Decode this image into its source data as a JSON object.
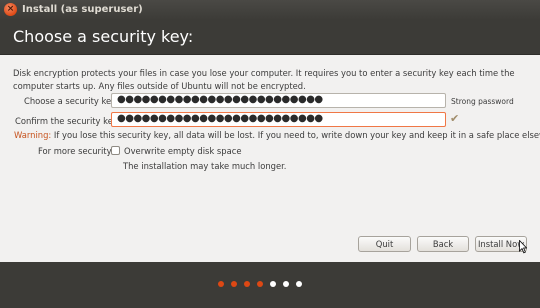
{
  "window": {
    "title": "Install (as superuser)",
    "close_glyph": "×"
  },
  "header": {
    "title": "Choose a security key:"
  },
  "main": {
    "description": "Disk encryption protects your files in case you lose your computer. It requires you to enter a security key each time the computer starts up. Any files outside of Ubuntu will not be encrypted.",
    "security_key": {
      "label": "Choose a security key:",
      "value": "●●●●●●●●●●●●●●●●●●●●●●●●●",
      "strength": "Strong password"
    },
    "confirm_key": {
      "label": "Confirm the security key:",
      "value": "●●●●●●●●●●●●●●●●●●●●●●●●●",
      "match_icon": "check-icon",
      "match_glyph": "✔"
    },
    "warning": {
      "label": "Warning:",
      "text": " If you lose this security key, all data will be lost. If you need to, write down your key and keep it in a safe place elsewhere."
    },
    "more_security": {
      "label": "For more security:",
      "checkbox_label": "Overwrite empty disk space",
      "checked": false,
      "note": "The installation may take much longer."
    }
  },
  "buttons": {
    "quit": "Quit",
    "back": "Back",
    "install": "Install Now"
  },
  "progress": {
    "total_steps": 7,
    "completed_steps": 4,
    "colors": {
      "done": "#dd4814",
      "pending": "#ffffff"
    }
  }
}
